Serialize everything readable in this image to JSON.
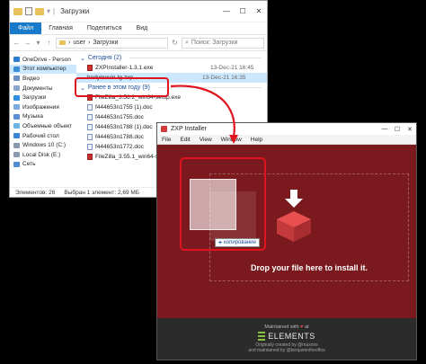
{
  "explorer": {
    "window_title": "Загрузки",
    "ribbon_tabs": [
      "Файл",
      "Главная",
      "Поделиться",
      "Вид"
    ],
    "address": {
      "crumbs": [
        "user",
        "Загрузки"
      ]
    },
    "search_placeholder": "Поиск: Загрузки",
    "nav_items": [
      {
        "label": "OneDrive - Person",
        "icon": "cloud-icon",
        "color": "#2b7cd3"
      },
      {
        "label": "Этот компьютер",
        "icon": "computer-icon",
        "color": "#3a8fd9",
        "selected": true
      },
      {
        "label": "Видео",
        "icon": "video-icon",
        "color": "#6a8fc4"
      },
      {
        "label": "Документы",
        "icon": "documents-icon",
        "color": "#8aa6cf"
      },
      {
        "label": "Загрузки",
        "icon": "downloads-icon",
        "color": "#2f8fe0"
      },
      {
        "label": "Изображения",
        "icon": "pictures-icon",
        "color": "#79a9e0"
      },
      {
        "label": "Музыка",
        "icon": "music-icon",
        "color": "#5c8fd8"
      },
      {
        "label": "Объемные объект",
        "icon": "3d-objects-icon",
        "color": "#6cb4e8"
      },
      {
        "label": "Рабочий стол",
        "icon": "desktop-icon",
        "color": "#3b84d6"
      },
      {
        "label": "Windows 10 (C:)",
        "icon": "drive-icon",
        "color": "#8a9bb0"
      },
      {
        "label": "Local Disk (E:)",
        "icon": "drive-icon",
        "color": "#8a9bb0"
      },
      {
        "label": "Сеть",
        "icon": "network-icon",
        "color": "#4f8fd1"
      }
    ],
    "groups": [
      {
        "header": "Сегодня (2)",
        "files": [
          {
            "name": "ZXPInstaller-1.3.1.exe",
            "date": "13-Dec-21 16:45",
            "type": "exe"
          },
          {
            "name": "bodymovin-tg.zxp",
            "date": "13-Dec-21 16:35",
            "type": "zxp",
            "selected": true
          }
        ]
      },
      {
        "header": "Ранее в этом году (9)",
        "files": [
          {
            "name": "FileZilla_3.56.2_win64-setup.exe",
            "date": "",
            "type": "exe"
          },
          {
            "name": "f444653n1755 (1).doc",
            "date": "",
            "type": "doc"
          },
          {
            "name": "f444653n1755.doc",
            "date": "",
            "type": "doc"
          },
          {
            "name": "f444653n1788 (1).doc",
            "date": "",
            "type": "doc"
          },
          {
            "name": "f444653n1788.doc",
            "date": "",
            "type": "doc"
          },
          {
            "name": "f444653n1772.doc",
            "date": "",
            "type": "doc"
          },
          {
            "name": "FileZilla_3.55.1_win64-setup.exe",
            "date": "",
            "type": "exe"
          }
        ]
      }
    ],
    "status": {
      "count": "Элементов: 26",
      "selected": "Выбран 1 элемент: 2,69 МБ"
    }
  },
  "zxp": {
    "window_title": "ZXP Installer",
    "menu": [
      "File",
      "Edit",
      "View",
      "Window",
      "Help"
    ],
    "drop_text": "Drop your file here to install it.",
    "copy_tooltip": "копирование",
    "footer": {
      "maintained": "Maintained with",
      "by": "at",
      "brand": "ELEMENTS",
      "credit_line1": "Originally created by @maxoos",
      "credit_line2": "and maintained by @benjamintheoffes"
    }
  },
  "colors": {
    "highlight": "#e0141f",
    "zxp_bg": "#7a1a1f",
    "footer_bg": "#2b2b2b",
    "elements_green": "#8ac43f",
    "explorer_accent": "#1979ca"
  }
}
